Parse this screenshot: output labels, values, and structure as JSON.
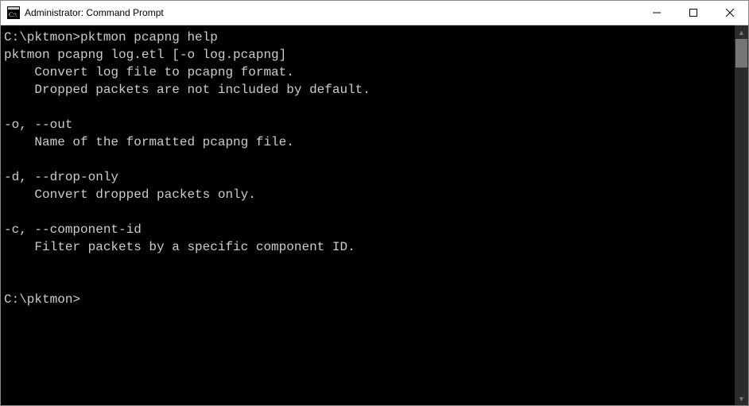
{
  "window": {
    "title": "Administrator: Command Prompt",
    "icon_name": "cmd-icon"
  },
  "terminal": {
    "lines": [
      {
        "prompt": "C:\\pktmon>",
        "command": "pktmon pcapng help"
      },
      "pktmon pcapng log.etl [-o log.pcapng]",
      "    Convert log file to pcapng format.",
      "    Dropped packets are not included by default.",
      "",
      "-o, --out",
      "    Name of the formatted pcapng file.",
      "",
      "-d, --drop-only",
      "    Convert dropped packets only.",
      "",
      "-c, --component-id",
      "    Filter packets by a specific component ID.",
      "",
      "",
      {
        "prompt": "C:\\pktmon>",
        "command": ""
      }
    ]
  }
}
